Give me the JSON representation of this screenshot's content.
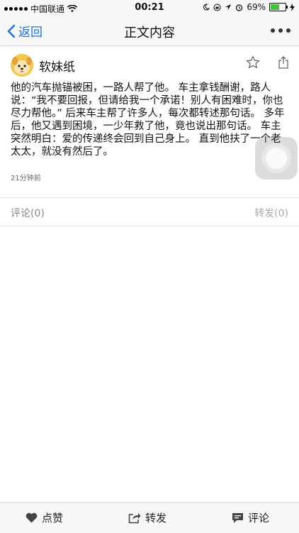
{
  "status_bar": {
    "carrier": "中国联通",
    "time": "00:21",
    "battery": "69%",
    "battery_level": 0.69
  },
  "nav": {
    "back_label": "返回",
    "title": "正文内容"
  },
  "post": {
    "author": "软妹纸",
    "content": "他的汽车抛锚被困，一路人帮了他。 车主拿钱酬谢，路人说：“我不要回报，但请给我一个承诺！别人有困难时，你也尽力帮他。” 后来车主帮了许多人，每次都转述那句话。 多年后，他又遇到困境，一少年救了他，竟也说出那句话。 车主突然明白：爱的传递终会回到自己身上。 直到他扶了一个老太太，就没有然后了。",
    "time_ago": "21分钟前"
  },
  "tabs": {
    "comment": "评论(0)",
    "forward": "转发(0)"
  },
  "toolbar": {
    "like": "点赞",
    "forward": "转发",
    "comment": "评论"
  },
  "colors": {
    "accent": "#1a73e8",
    "battery": "#3fc43f",
    "avatar": "#f3c64f"
  }
}
